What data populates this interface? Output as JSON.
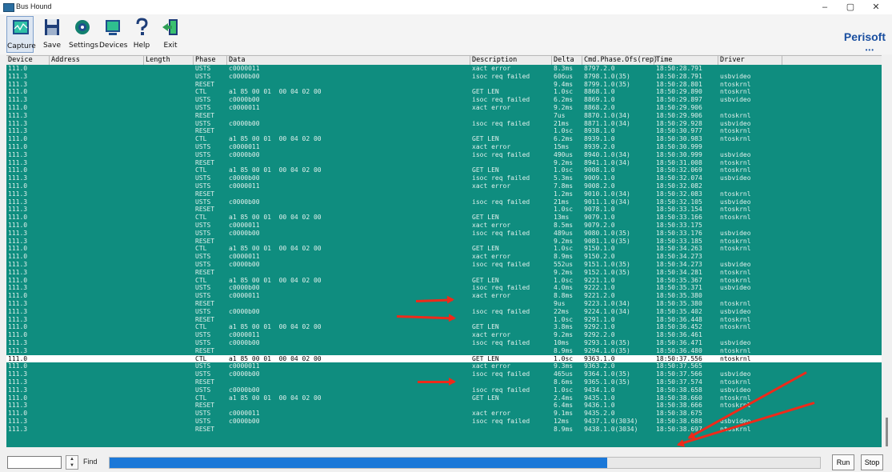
{
  "window": {
    "title": "Bus Hound",
    "controls": [
      "–",
      "▢",
      "✕"
    ]
  },
  "toolbar": {
    "buttons": [
      {
        "label": "Capture",
        "icon": "capture-icon"
      },
      {
        "label": "Save",
        "icon": "save-icon"
      },
      {
        "label": "Settings",
        "icon": "settings-icon"
      },
      {
        "label": "Devices",
        "icon": "devices-icon"
      },
      {
        "label": "Help",
        "icon": "help-icon"
      },
      {
        "label": "Exit",
        "icon": "exit-icon"
      }
    ],
    "brand": "Perisoft",
    "brand_dots": "•••"
  },
  "columns": [
    "Device",
    "Address",
    "Length",
    "Phase",
    "Data",
    "Description",
    "Delta",
    "Cmd.Phase.Ofs(rep)",
    "Time",
    "Driver"
  ],
  "rows": [
    [
      "111.0",
      "",
      "",
      "USTS",
      "c0000011",
      "xact error",
      "8.3ms",
      "8797.2.0",
      "18:50:28.791",
      ""
    ],
    [
      "111.3",
      "",
      "",
      "USTS",
      "c0000b00",
      "isoc req failed",
      "606us",
      "8798.1.0(35)",
      "18:50:28.791",
      "usbvideo"
    ],
    [
      "111.3",
      "",
      "",
      "RESET",
      "",
      "",
      "9.4ms",
      "8799.1.0(35)",
      "18:50:28.801",
      "ntoskrnl"
    ],
    [
      "111.0",
      "",
      "",
      "CTL",
      "a1 85 00 01  00 04 02 00",
      "GET LEN",
      "1.0sc",
      "8868.1.0",
      "18:50:29.890",
      "ntoskrnl"
    ],
    [
      "111.3",
      "",
      "",
      "USTS",
      "c0000b00",
      "isoc req failed",
      "6.2ms",
      "8869.1.0",
      "18:50:29.897",
      "usbvideo"
    ],
    [
      "111.0",
      "",
      "",
      "USTS",
      "c0000011",
      "xact error",
      "9.2ms",
      "8868.2.0",
      "18:50:29.906",
      ""
    ],
    [
      "111.3",
      "",
      "",
      "RESET",
      "",
      "",
      "7us",
      "8870.1.0(34)",
      "18:50:29.906",
      "ntoskrnl"
    ],
    [
      "111.3",
      "",
      "",
      "USTS",
      "c0000b00",
      "isoc req failed",
      "21ms",
      "8871.1.0(34)",
      "18:50:29.928",
      "usbvideo"
    ],
    [
      "111.3",
      "",
      "",
      "RESET",
      "",
      "",
      "1.0sc",
      "8938.1.0",
      "18:50:30.977",
      "ntoskrnl"
    ],
    [
      "111.0",
      "",
      "",
      "CTL",
      "a1 85 00 01  00 04 02 00",
      "GET LEN",
      "6.2ms",
      "8939.1.0",
      "18:50:30.983",
      "ntoskrnl"
    ],
    [
      "111.0",
      "",
      "",
      "USTS",
      "c0000011",
      "xact error",
      "15ms",
      "8939.2.0",
      "18:50:30.999",
      ""
    ],
    [
      "111.3",
      "",
      "",
      "USTS",
      "c0000b00",
      "isoc req failed",
      "490us",
      "8940.1.0(34)",
      "18:50:30.999",
      "usbvideo"
    ],
    [
      "111.3",
      "",
      "",
      "RESET",
      "",
      "",
      "9.2ms",
      "8941.1.0(34)",
      "18:50:31.008",
      "ntoskrnl"
    ],
    [
      "111.0",
      "",
      "",
      "CTL",
      "a1 85 00 01  00 04 02 00",
      "GET LEN",
      "1.0sc",
      "9008.1.0",
      "18:50:32.069",
      "ntoskrnl"
    ],
    [
      "111.3",
      "",
      "",
      "USTS",
      "c0000b00",
      "isoc req failed",
      "5.3ms",
      "9009.1.0",
      "18:50:32.074",
      "usbvideo"
    ],
    [
      "111.0",
      "",
      "",
      "USTS",
      "c0000011",
      "xact error",
      "7.8ms",
      "9008.2.0",
      "18:50:32.082",
      ""
    ],
    [
      "111.3",
      "",
      "",
      "RESET",
      "",
      "",
      "1.2ms",
      "9010.1.0(34)",
      "18:50:32.083",
      "ntoskrnl"
    ],
    [
      "111.3",
      "",
      "",
      "USTS",
      "c0000b00",
      "isoc req failed",
      "21ms",
      "9011.1.0(34)",
      "18:50:32.105",
      "usbvideo"
    ],
    [
      "111.3",
      "",
      "",
      "RESET",
      "",
      "",
      "1.0sc",
      "9078.1.0",
      "18:50:33.154",
      "ntoskrnl"
    ],
    [
      "111.0",
      "",
      "",
      "CTL",
      "a1 85 00 01  00 04 02 00",
      "GET LEN",
      "13ms",
      "9079.1.0",
      "18:50:33.166",
      "ntoskrnl"
    ],
    [
      "111.0",
      "",
      "",
      "USTS",
      "c0000011",
      "xact error",
      "8.5ms",
      "9079.2.0",
      "18:50:33.175",
      ""
    ],
    [
      "111.3",
      "",
      "",
      "USTS",
      "c0000b00",
      "isoc req failed",
      "489us",
      "9080.1.0(35)",
      "18:50:33.176",
      "usbvideo"
    ],
    [
      "111.3",
      "",
      "",
      "RESET",
      "",
      "",
      "9.2ms",
      "9081.1.0(35)",
      "18:50:33.185",
      "ntoskrnl"
    ],
    [
      "111.0",
      "",
      "",
      "CTL",
      "a1 85 00 01  00 04 02 00",
      "GET LEN",
      "1.0sc",
      "9150.1.0",
      "18:50:34.263",
      "ntoskrnl"
    ],
    [
      "111.0",
      "",
      "",
      "USTS",
      "c0000011",
      "xact error",
      "8.9ms",
      "9150.2.0",
      "18:50:34.273",
      ""
    ],
    [
      "111.3",
      "",
      "",
      "USTS",
      "c0000b00",
      "isoc req failed",
      "552us",
      "9151.1.0(35)",
      "18:50:34.273",
      "usbvideo"
    ],
    [
      "111.3",
      "",
      "",
      "RESET",
      "",
      "",
      "9.2ms",
      "9152.1.0(35)",
      "18:50:34.281",
      "ntoskrnl"
    ],
    [
      "111.0",
      "",
      "",
      "CTL",
      "a1 85 00 01  00 04 02 00",
      "GET LEN",
      "1.0sc",
      "9221.1.0",
      "18:50:35.367",
      "ntoskrnl"
    ],
    [
      "111.3",
      "",
      "",
      "USTS",
      "c0000b00",
      "isoc req failed",
      "4.0ms",
      "9222.1.0",
      "18:50:35.371",
      "usbvideo"
    ],
    [
      "111.0",
      "",
      "",
      "USTS",
      "c0000011",
      "xact error",
      "8.8ms",
      "9221.2.0",
      "18:50:35.380",
      ""
    ],
    [
      "111.3",
      "",
      "",
      "RESET",
      "",
      "",
      "9us",
      "9223.1.0(34)",
      "18:50:35.380",
      "ntoskrnl"
    ],
    [
      "111.3",
      "",
      "",
      "USTS",
      "c0000b00",
      "isoc req failed",
      "22ms",
      "9224.1.0(34)",
      "18:50:35.402",
      "usbvideo"
    ],
    [
      "111.3",
      "",
      "",
      "RESET",
      "",
      "",
      "1.0sc",
      "9291.1.0",
      "18:50:36.448",
      "ntoskrnl"
    ],
    [
      "111.0",
      "",
      "",
      "CTL",
      "a1 85 00 01  00 04 02 00",
      "GET LEN",
      "3.8ms",
      "9292.1.0",
      "18:50:36.452",
      "ntoskrnl"
    ],
    [
      "111.0",
      "",
      "",
      "USTS",
      "c0000011",
      "xact error",
      "9.2ms",
      "9292.2.0",
      "18:50:36.461",
      ""
    ],
    [
      "111.3",
      "",
      "",
      "USTS",
      "c0000b00",
      "isoc req failed",
      "10ms",
      "9293.1.0(35)",
      "18:50:36.471",
      "usbvideo"
    ],
    [
      "111.3",
      "",
      "",
      "RESET",
      "",
      "",
      "8.9ms",
      "9294.1.0(35)",
      "18:50:36.480",
      "ntoskrnl"
    ],
    [
      "111.0",
      "",
      "",
      "CTL",
      "a1 85 00 01  00 04 02 00",
      "GET LEN",
      "1.0sc",
      "9363.1.0",
      "18:50:37.556",
      "ntoskrnl"
    ],
    [
      "111.0",
      "",
      "",
      "USTS",
      "c0000011",
      "xact error",
      "9.3ms",
      "9363.2.0",
      "18:50:37.565",
      ""
    ],
    [
      "111.3",
      "",
      "",
      "USTS",
      "c0000b00",
      "isoc req failed",
      "465us",
      "9364.1.0(35)",
      "18:50:37.566",
      "usbvideo"
    ],
    [
      "111.3",
      "",
      "",
      "RESET",
      "",
      "",
      "8.6ms",
      "9365.1.0(35)",
      "18:50:37.574",
      "ntoskrnl"
    ],
    [
      "111.3",
      "",
      "",
      "USTS",
      "c0000b00",
      "isoc req failed",
      "1.0sc",
      "9434.1.0",
      "18:50:38.658",
      "usbvideo"
    ],
    [
      "111.0",
      "",
      "",
      "CTL",
      "a1 85 00 01  00 04 02 00",
      "GET LEN",
      "2.4ms",
      "9435.1.0",
      "18:50:38.660",
      "ntoskrnl"
    ],
    [
      "111.3",
      "",
      "",
      "RESET",
      "",
      "",
      "6.4ms",
      "9436.1.0",
      "18:50:38.666",
      "ntoskrnl"
    ],
    [
      "111.0",
      "",
      "",
      "USTS",
      "c0000011",
      "xact error",
      "9.1ms",
      "9435.2.0",
      "18:50:38.675",
      ""
    ],
    [
      "111.3",
      "",
      "",
      "USTS",
      "c0000b00",
      "isoc req failed",
      "12ms",
      "9437.1.0(3034)",
      "18:50:38.688",
      "usbvideo"
    ],
    [
      "111.3",
      "",
      "",
      "RESET",
      "",
      "",
      "8.9ms",
      "9438.1.0(3034)",
      "18:50:38.697",
      "ntoskrnl"
    ]
  ],
  "selected_row_index": 37,
  "statusbar": {
    "find_value": "",
    "find_label": "Find",
    "progress": 0.7,
    "run_label": "Run",
    "stop_label": "Stop"
  },
  "colors": {
    "grid_bg": "#0f8d7f",
    "grid_text": "#dff0ec",
    "selection_bg": "#ffffff",
    "annotation_arrow": "#ee2a1a",
    "progress_fill": "#1b78d8"
  }
}
